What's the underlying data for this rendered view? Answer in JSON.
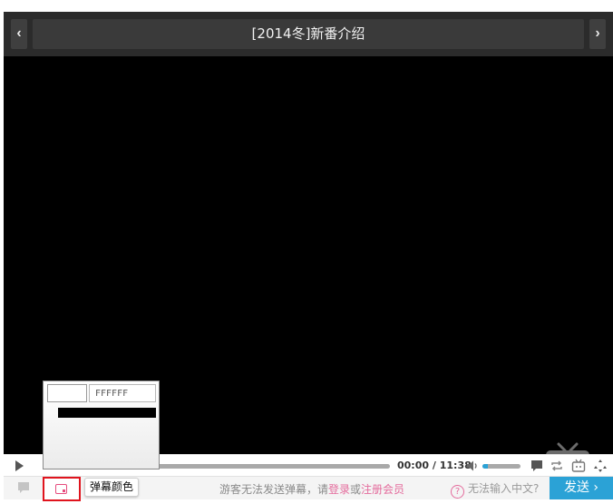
{
  "title": "[2014冬]新番介绍",
  "nav": {
    "prev": "‹",
    "next": "›"
  },
  "player": {
    "current_time": "00:00",
    "separator": "/",
    "duration": "11:38",
    "volume_fraction": 0.15,
    "progress_fraction": 0.0
  },
  "danmaku": {
    "tooltip": "弹幕颜色",
    "msg_prefix": "游客无法发送弹幕，请",
    "login": "登录",
    "or": "或",
    "register": "注册会员",
    "help_icon": "?",
    "help": "无法输入中文?",
    "send": "发送 ›"
  },
  "color_picker": {
    "hex_value": "FFFFFF",
    "preview_color": "#FFFFFF"
  },
  "colors": {
    "accent_blue": "#2ba2d6",
    "accent_pink": "#e46b9c",
    "highlight_red": "#e0141e"
  },
  "icons": {
    "play": "play-icon",
    "volume": "volume-icon",
    "danmaku_toggle": "danmaku-toggle-icon",
    "color": "color-palette-icon",
    "tv": "tv-logo-icon"
  }
}
